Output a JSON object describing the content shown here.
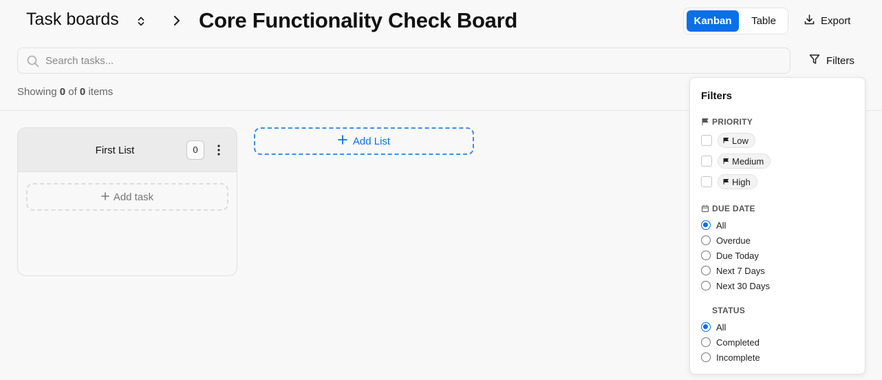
{
  "header": {
    "breadcrumb_root": "Task boards",
    "board_title": "Core Functionality Check Board",
    "views": {
      "kanban": "Kanban",
      "table": "Table",
      "active": "kanban"
    },
    "export_label": "Export"
  },
  "search": {
    "placeholder": "Search tasks...",
    "value": ""
  },
  "filters_button_label": "Filters",
  "summary": {
    "prefix": "Showing",
    "shown": "0",
    "of": "of",
    "total": "0",
    "suffix": "items"
  },
  "lists": [
    {
      "title": "First List",
      "count": "0",
      "add_task_label": "Add task"
    }
  ],
  "add_list_label": "Add List",
  "filters_panel": {
    "title": "Filters",
    "priority": {
      "heading": "PRIORITY",
      "options": [
        {
          "label": "Low",
          "checked": false
        },
        {
          "label": "Medium",
          "checked": false
        },
        {
          "label": "High",
          "checked": false
        }
      ]
    },
    "due_date": {
      "heading": "DUE DATE",
      "options": [
        "All",
        "Overdue",
        "Due Today",
        "Next 7 Days",
        "Next 30 Days"
      ],
      "selected": "All"
    },
    "status": {
      "heading": "STATUS",
      "options": [
        "All",
        "Completed",
        "Incomplete"
      ],
      "selected": "All"
    }
  },
  "colors": {
    "accent": "#0a6fe8",
    "background": "#f8f8f8",
    "panel": "#ffffff"
  }
}
